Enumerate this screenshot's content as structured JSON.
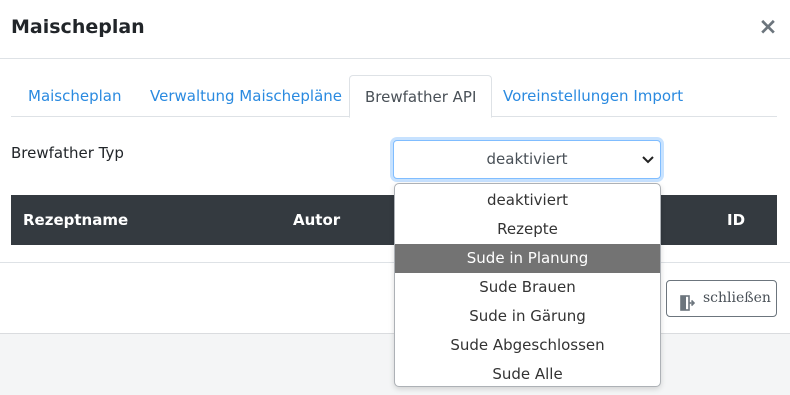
{
  "modal": {
    "title": "Maischeplan",
    "close_glyph": "×"
  },
  "tabs": [
    {
      "label": "Maischeplan",
      "active": false
    },
    {
      "label": "Verwaltung Maischepläne",
      "active": false
    },
    {
      "label": "Brewfather API",
      "active": true
    },
    {
      "label": "Voreinstellungen Import",
      "active": false
    }
  ],
  "form": {
    "label": "Brewfather Typ",
    "selected": "deaktiviert",
    "chevron_icon": "chevron-down-icon"
  },
  "dropdown": {
    "options": [
      "deaktiviert",
      "Rezepte",
      "Sude in Planung",
      "Sude Brauen",
      "Sude in Gärung",
      "Sude Abgeschlossen",
      "Sude Alle"
    ],
    "highlighted": "Sude in Planung"
  },
  "table": {
    "columns": [
      "Rezeptname",
      "Autor",
      "ID"
    ]
  },
  "footer": {
    "close_label": "schließen",
    "close_icon": "door-exit-icon"
  },
  "colors": {
    "link": "#2a8ae0",
    "table_header_bg": "#343a40",
    "highlight": "#737373",
    "focus": "#80bdff"
  }
}
